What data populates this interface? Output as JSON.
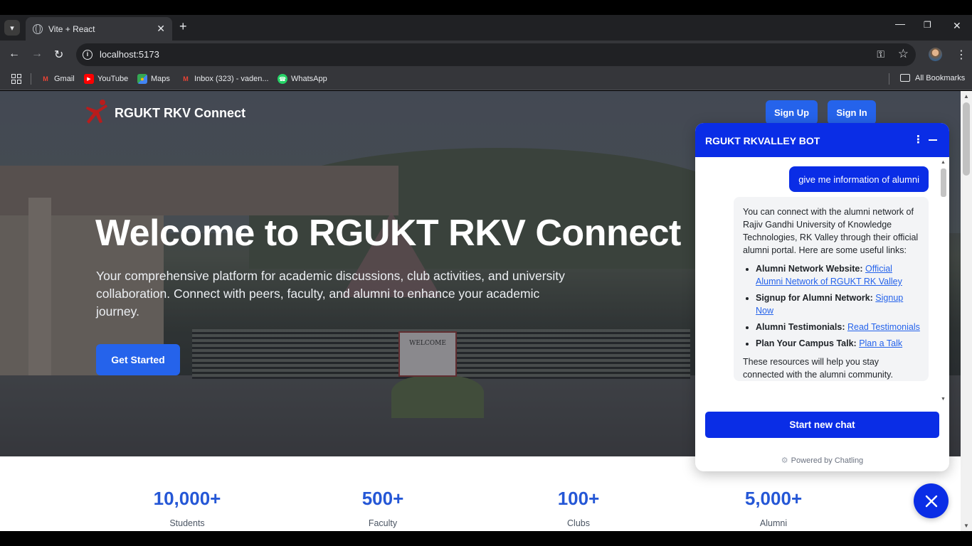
{
  "browser": {
    "tab_title": "Vite + React",
    "url": "localhost:5173",
    "bookmarks": [
      {
        "label": "Gmail",
        "icon": "gmail-icon",
        "color": "#ea4335"
      },
      {
        "label": "YouTube",
        "icon": "youtube-icon",
        "color": "#ff0000"
      },
      {
        "label": "Maps",
        "icon": "maps-icon",
        "color": "#34a853"
      },
      {
        "label": "Inbox (323) - vaden...",
        "icon": "gmail-icon",
        "color": "#ea4335"
      },
      {
        "label": "WhatsApp",
        "icon": "whatsapp-icon",
        "color": "#25d366"
      }
    ],
    "all_bookmarks": "All Bookmarks"
  },
  "site": {
    "brand": "RGUKT RKV Connect",
    "signup_label": "Sign Up",
    "signin_label": "Sign In",
    "hero_title": "Welcome to RGUKT RKV Connect",
    "hero_subtitle": "Your comprehensive platform for academic discussions, club activities, and university collaboration. Connect with peers, faculty, and alumni to enhance your academic journey.",
    "cta_label": "Get Started",
    "board_text": "WELCOME",
    "accent_color": "#2563eb",
    "stats": [
      {
        "value": "10,000+",
        "label": "Students"
      },
      {
        "value": "500+",
        "label": "Faculty"
      },
      {
        "value": "100+",
        "label": "Clubs"
      },
      {
        "value": "5,000+",
        "label": "Alumni"
      }
    ]
  },
  "chatbot": {
    "title": "RGUKT RKVALLEY BOT",
    "header_color": "#0a2de6",
    "user_message": "give me information of alumni",
    "bot_intro": "You can connect with the alumni network of Rajiv Gandhi University of Knowledge Technologies, RK Valley through their official alumni portal. Here are some useful links:",
    "bot_items": [
      {
        "label": "Alumni Network Website:",
        "link": "Official Alumni Network of RGUKT RK Valley"
      },
      {
        "label": "Signup for Alumni Network:",
        "link": "Signup Now"
      },
      {
        "label": "Alumni Testimonials:",
        "link": "Read Testimonials"
      },
      {
        "label": "Plan Your Campus Talk:",
        "link": "Plan a Talk"
      }
    ],
    "bot_closing": "These resources will help you stay connected with the alumni community.",
    "new_chat_label": "Start new chat",
    "powered_by": "Powered by Chatling"
  }
}
